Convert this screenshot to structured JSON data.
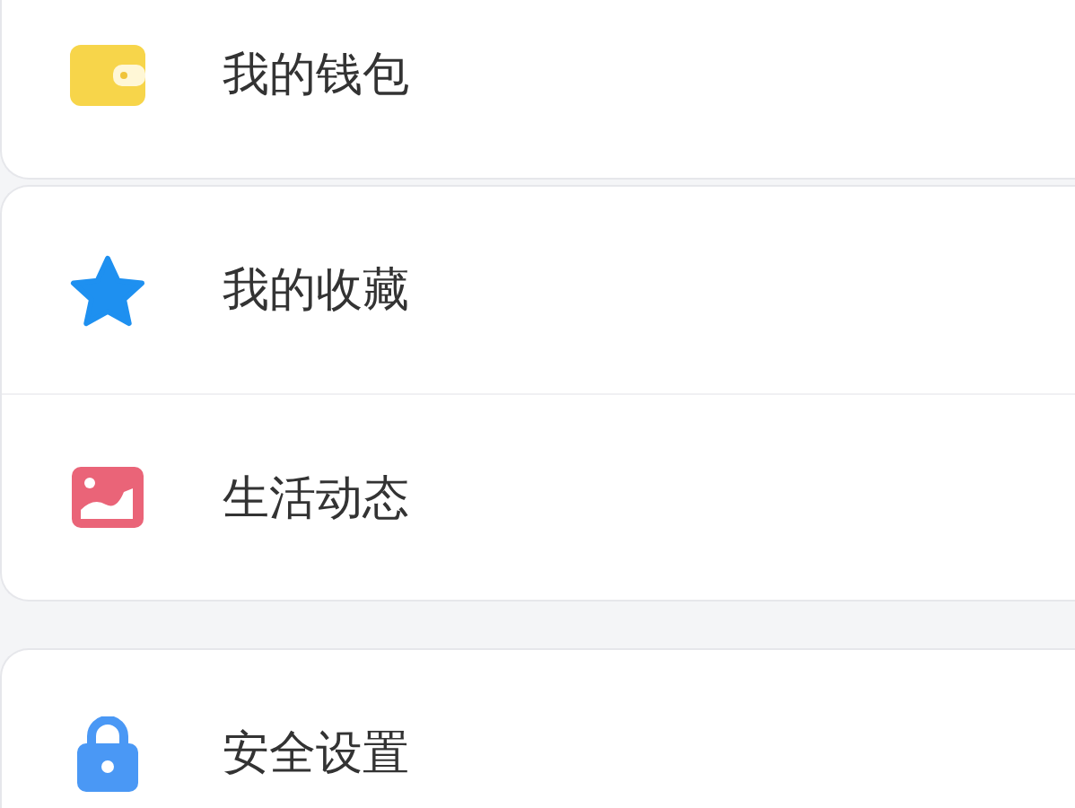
{
  "groups": [
    {
      "items": [
        {
          "kind": "wallet",
          "label": "我的钱包"
        }
      ]
    },
    {
      "items": [
        {
          "kind": "star",
          "label": "我的收藏"
        },
        {
          "kind": "picture",
          "label": "生活动态"
        }
      ]
    },
    {
      "items": [
        {
          "kind": "lock",
          "label": "安全设置"
        }
      ]
    }
  ]
}
